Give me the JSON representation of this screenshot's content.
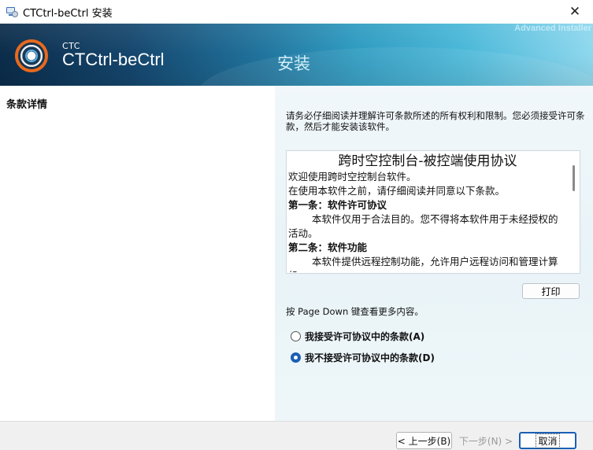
{
  "window": {
    "title": "CTCtrl-beCtrl 安装",
    "close_glyph": "✕"
  },
  "banner": {
    "logo_small": "CTC",
    "logo_big": "CTCtrl-beCtrl",
    "title": "安装",
    "brand": "Advanced Installer"
  },
  "left": {
    "title": "条款详情"
  },
  "right": {
    "instructions": "请务必仔细阅读并理解许可条款所述的所有权利和限制。您必须接受许可条款，然后才能安装该软件。",
    "license": {
      "title": "跨时空控制台-被控端使用协议",
      "line1": "欢迎使用跨时空控制台软件。",
      "line2": "在使用本软件之前，请仔细阅读并同意以下条款。",
      "h1": "第一条：软件许可协议",
      "p1": "本软件仅用于合法目的。您不得将本软件用于未经授权的活动。",
      "h2": "第二条：软件功能",
      "p2": "本软件提供远程控制功能，允许用户远程访问和管理计算机。"
    },
    "print_label": "打印",
    "pagedown_hint": "按 Page Down 键查看更多内容。",
    "radio_accept": "我接受许可协议中的条款(A)",
    "radio_decline": "我不接受许可协议中的条款(D)",
    "selected": "decline"
  },
  "footer": {
    "back_label": "< 上一步(B)",
    "next_label": "下一步(N) >",
    "cancel_label": "取消"
  },
  "colors": {
    "accent": "#1a5fb4",
    "logo_orange": "#e86a1f"
  },
  "icons": {
    "app": "installer-app-icon",
    "close": "close-icon",
    "logo": "ctc-logo-icon"
  }
}
